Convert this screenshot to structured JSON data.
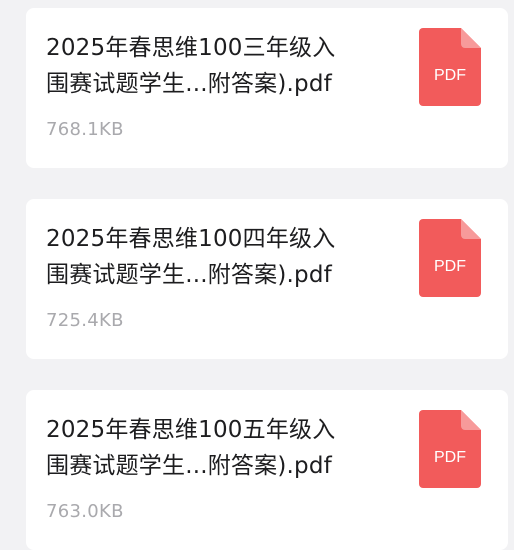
{
  "files": [
    {
      "name": "2025年春思维100三年级入\n围赛试题学生...附答案).pdf",
      "size": "768.1KB",
      "icon": "pdf-file-icon",
      "icon_label": "PDF",
      "icon_color": "#f25b5b"
    },
    {
      "name": "2025年春思维100四年级入\n围赛试题学生...附答案).pdf",
      "size": "725.4KB",
      "icon": "pdf-file-icon",
      "icon_label": "PDF",
      "icon_color": "#f25b5b"
    },
    {
      "name": "2025年春思维100五年级入\n围赛试题学生...附答案).pdf",
      "size": "763.0KB",
      "icon": "pdf-file-icon",
      "icon_label": "PDF",
      "icon_color": "#f25b5b"
    }
  ]
}
